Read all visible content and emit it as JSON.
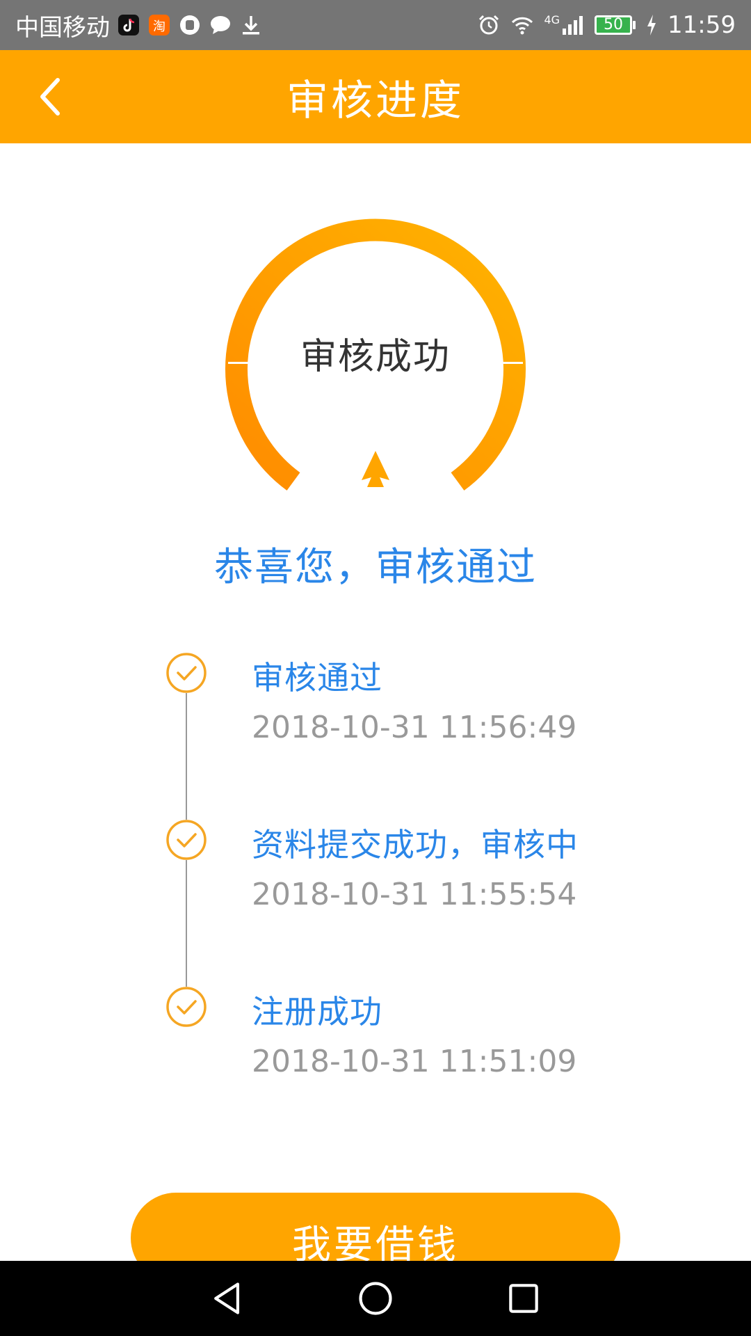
{
  "status_bar": {
    "carrier": "中国移动",
    "notification_icons": [
      "tiktok-icon",
      "taobao-icon",
      "stop-hand-icon",
      "chat-bubble-icon",
      "download-icon"
    ],
    "network_label": "4G",
    "battery_level": "50",
    "time": "11:59"
  },
  "header": {
    "title": "审核进度",
    "back_icon": "chevron-left-icon"
  },
  "gauge": {
    "label": "审核成功",
    "color_start": "#FF8C00",
    "color_end": "#FFB300"
  },
  "congrats": "恭喜您，审核通过",
  "timeline": {
    "items": [
      {
        "title": "审核通过",
        "time": "2018-10-31 11:56:49"
      },
      {
        "title": "资料提交成功，审核中",
        "time": "2018-10-31 11:55:54"
      },
      {
        "title": "注册成功",
        "time": "2018-10-31 11:51:09"
      }
    ]
  },
  "actions": {
    "borrow_label": "我要借钱"
  },
  "colors": {
    "accent": "#FFA500",
    "link_blue": "#2a86e8",
    "muted_gray": "#999999"
  },
  "nav_bar": {
    "buttons": [
      "back-triangle-icon",
      "home-circle-icon",
      "recents-square-icon"
    ]
  }
}
